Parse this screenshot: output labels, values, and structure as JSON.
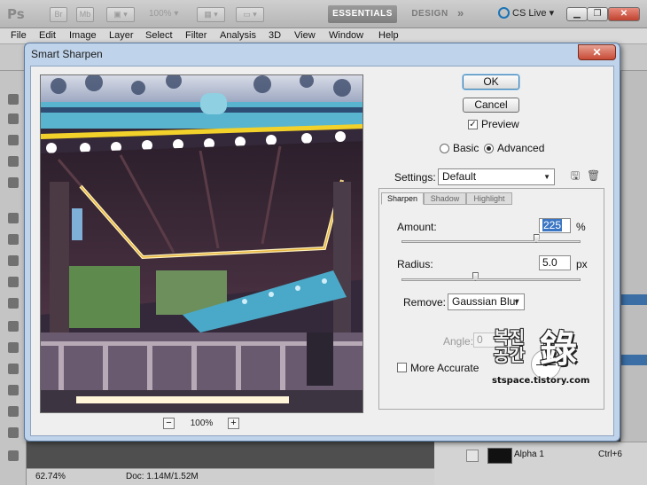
{
  "app": {
    "logo": "Ps",
    "bridge_label": "Br",
    "minibridge_label": "Mb",
    "zoom_level": "100%",
    "workspaces": [
      "ESSENTIALS",
      "DESIGN"
    ],
    "more_glyph": "»",
    "cs_live": "CS Live"
  },
  "menu": [
    "File",
    "Edit",
    "Image",
    "Layer",
    "Select",
    "Filter",
    "Analysis",
    "3D",
    "View",
    "Window",
    "Help"
  ],
  "status": {
    "zoom": "62.74%",
    "doc": "Doc: 1.14M/1.52M"
  },
  "layers_panel": {
    "layer_name": "Alpha 1",
    "shortcut": "Ctrl+6"
  },
  "dialog": {
    "title": "Smart Sharpen",
    "close_glyph": "✕",
    "ok_label": "OK",
    "cancel_label": "Cancel",
    "preview_label": "Preview",
    "preview_checked": true,
    "mode_options": [
      "Basic",
      "Advanced"
    ],
    "mode_selected": "Advanced",
    "settings_label": "Settings:",
    "settings_value": "Default",
    "tabs": [
      "Sharpen",
      "Shadow",
      "Highlight"
    ],
    "active_tab": "Sharpen",
    "amount_label": "Amount:",
    "amount_value": "225",
    "amount_unit": "%",
    "amount_fraction": 0.75,
    "radius_label": "Radius:",
    "radius_value": "5.0",
    "radius_unit": "px",
    "radius_fraction": 0.41,
    "remove_label": "Remove:",
    "remove_value": "Gaussian Blur",
    "angle_label": "Angle:",
    "angle_value": "0",
    "angle_unit": "°",
    "more_accurate_label": "More Accurate",
    "more_accurate_checked": false,
    "preview_zoom": "100%"
  },
  "watermark": {
    "korean_top": "복진",
    "korean_bottom": "공간",
    "hanja": "錄",
    "url": "stspace.tistory.com"
  },
  "colors": {
    "accent": "#3a76c4",
    "dialog_frame": "#bfd3ea",
    "close_button": "#c74a36"
  }
}
